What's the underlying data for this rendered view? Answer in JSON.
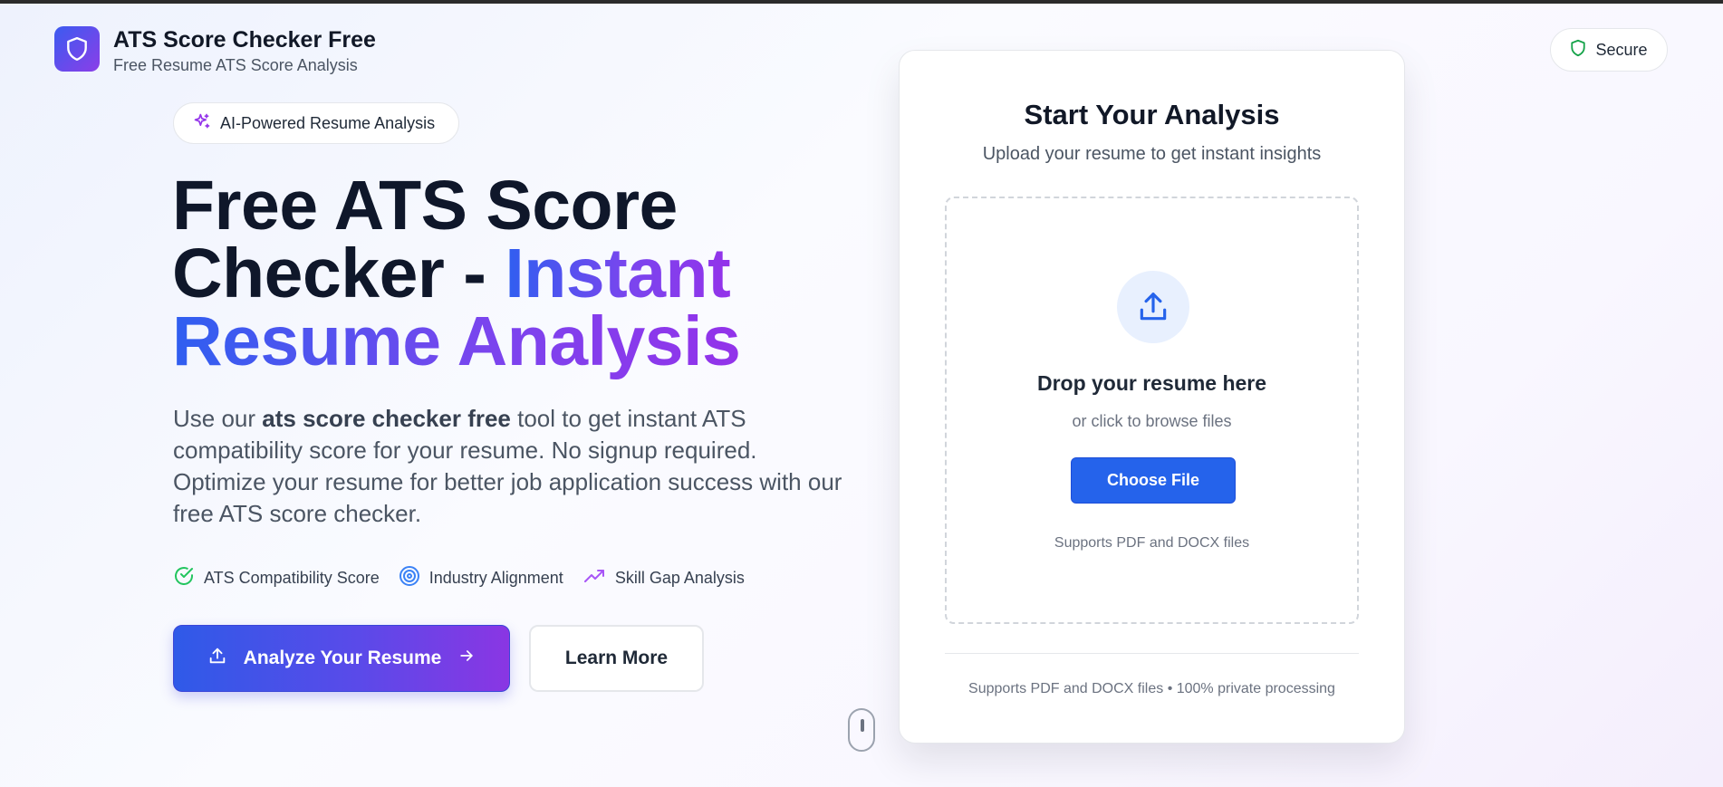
{
  "header": {
    "title": "ATS Score Checker Free",
    "subtitle": "Free Resume ATS Score Analysis",
    "logo_icon": "shield-icon",
    "secure_label": "Secure",
    "secure_icon": "shield-icon"
  },
  "hero": {
    "badge": "AI-Powered Resume Analysis",
    "badge_icon": "sparkles-icon",
    "title_line1": "Free ATS Score",
    "title_line2_plain": "Checker - ",
    "title_line2_highlight": "Instant",
    "title_line3_highlight": "Resume Analysis",
    "desc_prefix": "Use our ",
    "desc_bold": "ats score checker free",
    "desc_suffix": " tool to get instant ATS compatibility score for your resume. No signup required. Optimize your resume for better job application success with our free ATS score checker.",
    "features": [
      {
        "label": "ATS Compatibility Score",
        "icon": "check-circle-icon",
        "color": "#22c55e"
      },
      {
        "label": "Industry Alignment",
        "icon": "target-icon",
        "color": "#3b82f6"
      },
      {
        "label": "Skill Gap Analysis",
        "icon": "trending-up-icon",
        "color": "#a855f7"
      }
    ],
    "primary_button": "Analyze Your Resume",
    "secondary_button": "Learn More"
  },
  "card": {
    "title": "Start Your Analysis",
    "subtitle": "Upload your resume to get instant insights",
    "drop_title": "Drop your resume here",
    "drop_sub": "or click to browse files",
    "choose_button": "Choose File",
    "drop_note": "Supports PDF and DOCX files",
    "footer": "Supports PDF and DOCX files • 100% private processing"
  },
  "colors": {
    "brand_gradient_start": "#3b5bf0",
    "brand_gradient_end": "#8b3ee8",
    "primary_blue": "#2563eb"
  }
}
